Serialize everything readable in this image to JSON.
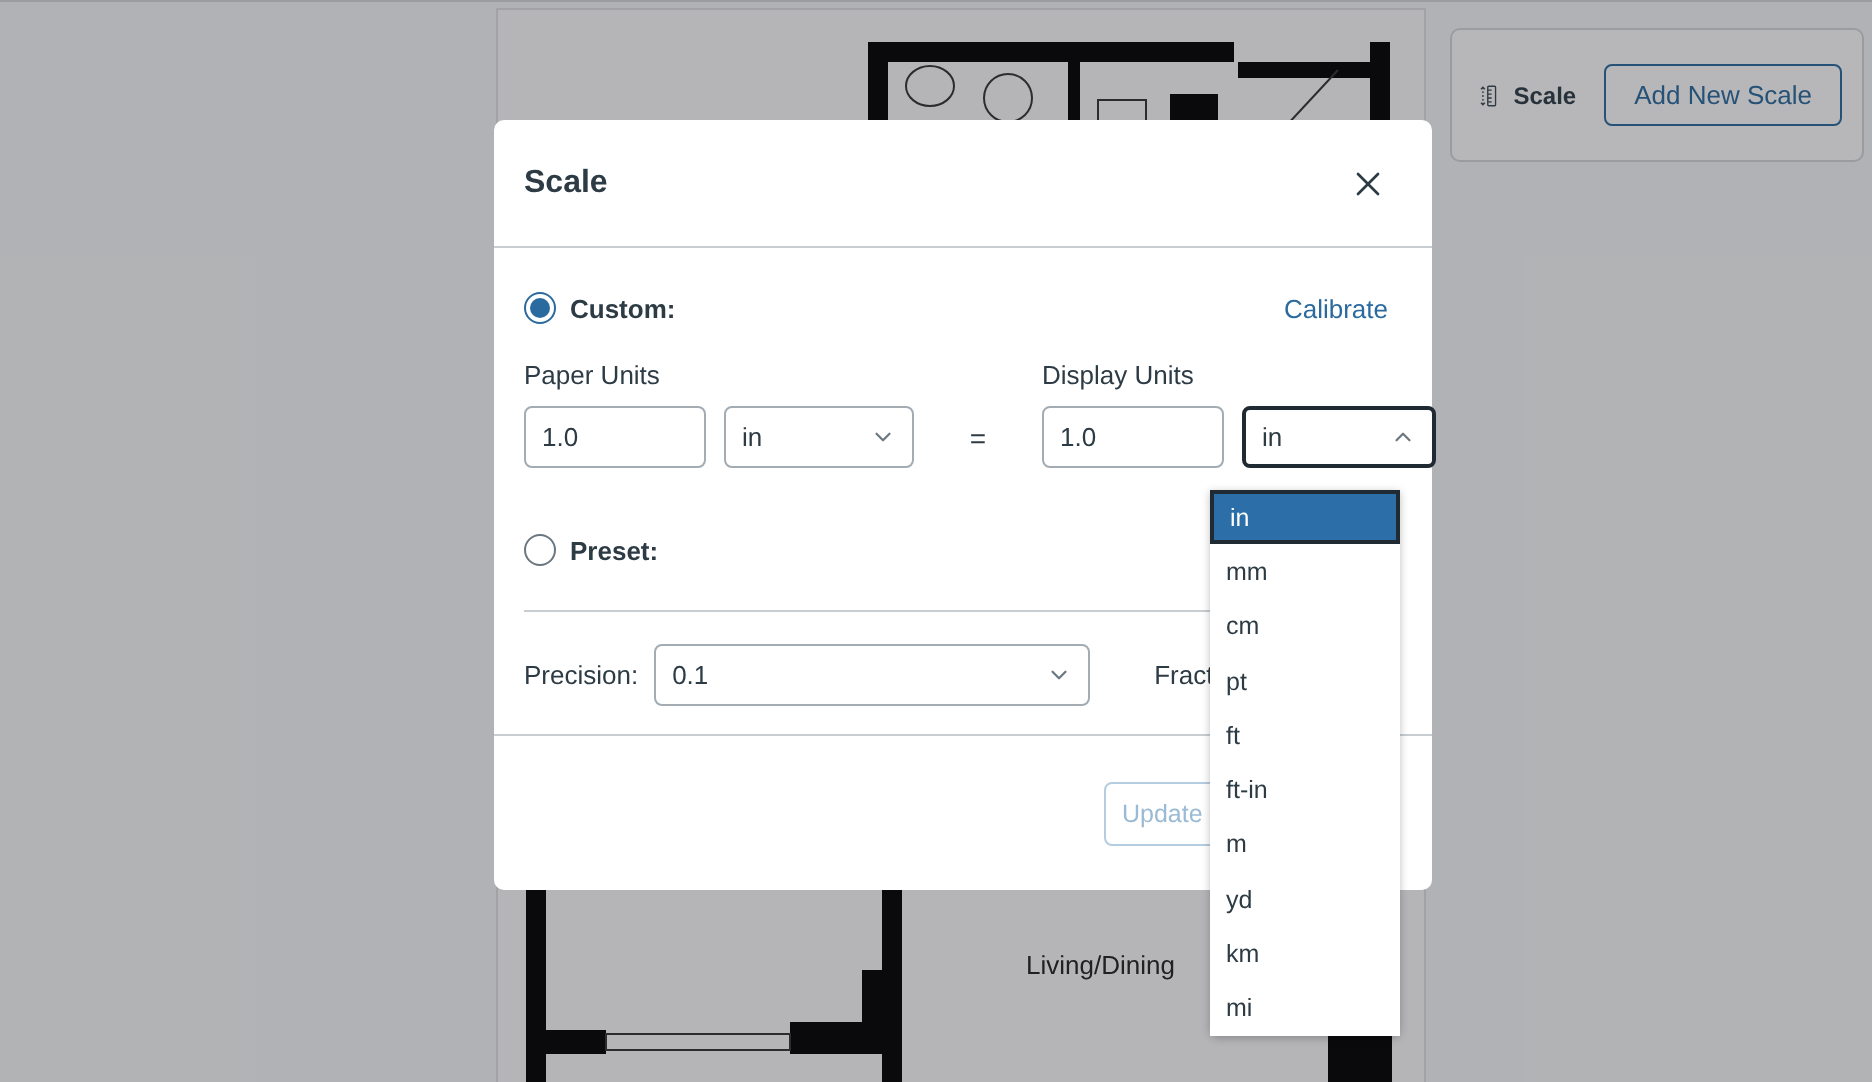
{
  "toolbar": {
    "label": "Scale",
    "button": "Add New Scale"
  },
  "floor_plan": {
    "room_label": "Living/Dining"
  },
  "dialog": {
    "title": "Scale",
    "modes": [
      {
        "label": "Custom:",
        "selected": true
      },
      {
        "label": "Preset:",
        "selected": false
      }
    ],
    "calibrate_link": "Calibrate",
    "paper_units": {
      "label": "Paper Units",
      "value": "1.0",
      "unit": "in"
    },
    "equals": "=",
    "display_units": {
      "label": "Display Units",
      "value": "1.0",
      "unit": "in",
      "expanded": true
    },
    "unit_options": [
      {
        "label": "in",
        "selected": true
      },
      {
        "label": "mm",
        "selected": false
      },
      {
        "label": "cm",
        "selected": false
      },
      {
        "label": "pt",
        "selected": false
      },
      {
        "label": "ft",
        "selected": false
      },
      {
        "label": "ft-in",
        "selected": false
      },
      {
        "label": "m",
        "selected": false
      },
      {
        "label": "yd",
        "selected": false
      },
      {
        "label": "km",
        "selected": false
      },
      {
        "label": "mi",
        "selected": false
      }
    ],
    "precision": {
      "label": "Precision:",
      "value": "0.1"
    },
    "fraction_label": "Fract",
    "update_button": {
      "label": "Update",
      "disabled": true
    }
  }
}
